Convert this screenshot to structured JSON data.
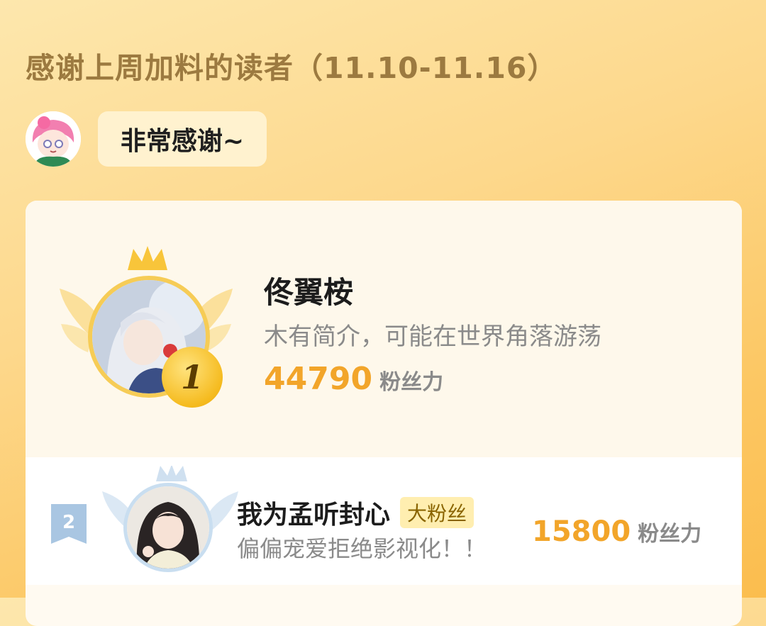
{
  "header": {
    "title": "感谢上周加料的读者（11.10-11.16）",
    "thanks_message": "非常感谢~"
  },
  "ranking": [
    {
      "rank": "1",
      "name": "佟翼桉",
      "bio": "木有简介，可能在世界角落游荡",
      "score": "44790",
      "score_unit": "粉丝力"
    },
    {
      "rank": "2",
      "name": "我为孟听封心",
      "badge": "大粉丝",
      "bio": "偏偏宠爱拒绝影视化！！",
      "score": "15800",
      "score_unit": "粉丝力"
    }
  ],
  "colors": {
    "accent_orange": "#f2a52a",
    "gold": "#f5bb1f",
    "silver_blue": "#c9def0"
  }
}
